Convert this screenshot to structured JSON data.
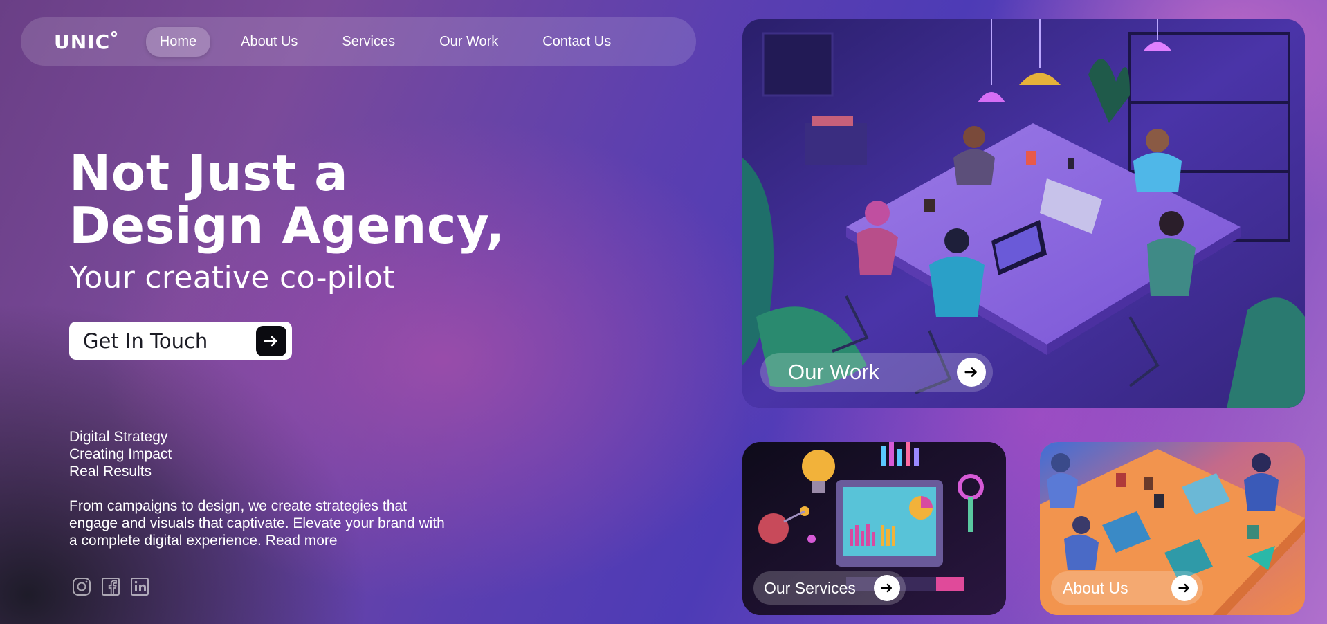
{
  "brand": {
    "name": "UNIC",
    "mark": "o"
  },
  "nav": {
    "items": [
      {
        "label": "Home",
        "active": true
      },
      {
        "label": "About Us",
        "active": false
      },
      {
        "label": "Services",
        "active": false
      },
      {
        "label": "Our Work",
        "active": false
      },
      {
        "label": "Contact Us",
        "active": false
      }
    ]
  },
  "hero": {
    "title_line1": "Not Just a",
    "title_line2": "Design Agency,",
    "subtitle": "Your creative co-pilot",
    "cta_label": "Get In Touch"
  },
  "taglines": [
    "Digital Strategy",
    "Creating Impact",
    "Real Results"
  ],
  "description": {
    "text": "From campaigns to design, we create strategies that engage and visuals that captivate. Elevate your brand with a complete digital experience.",
    "link": "Read more"
  },
  "socials": [
    {
      "icon": "instagram-icon"
    },
    {
      "icon": "facebook-icon"
    },
    {
      "icon": "linkedin-icon"
    }
  ],
  "cards": {
    "work": {
      "label": "Our Work"
    },
    "services": {
      "label": "Our Services"
    },
    "about": {
      "label": "About Us"
    }
  },
  "colors": {
    "cta_background": "#ffffff",
    "cta_arrow_background": "#0b0b10",
    "chip_arrow_background": "#ffffff",
    "text": "#ffffff"
  }
}
